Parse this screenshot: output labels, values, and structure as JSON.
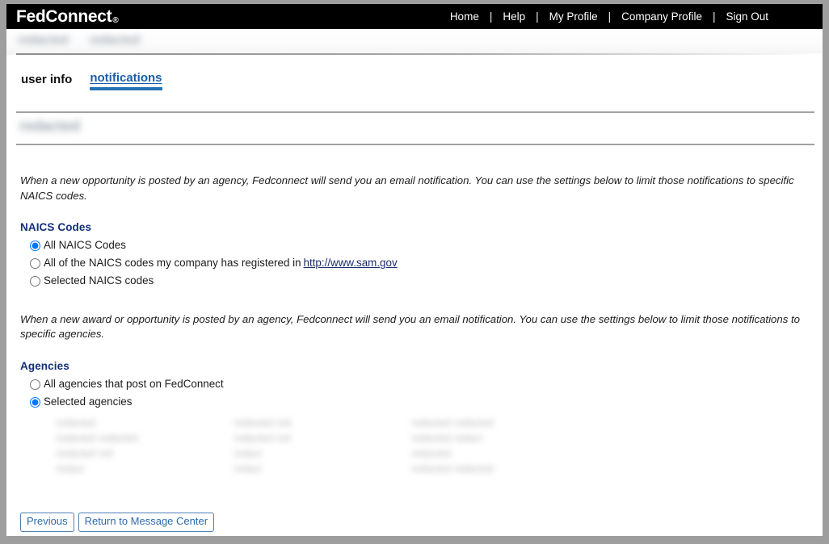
{
  "header": {
    "brand": "FedConnect",
    "brand_mark": "®",
    "nav": [
      {
        "label": "Home"
      },
      {
        "label": "Help"
      },
      {
        "label": "My Profile"
      },
      {
        "label": "Company Profile"
      },
      {
        "label": "Sign Out"
      }
    ],
    "nav_separator": "|"
  },
  "breadcrumb": {
    "item1": "redacted",
    "item2": "redacted"
  },
  "tabs": [
    {
      "label": "user info",
      "active": false
    },
    {
      "label": "notifications",
      "active": true
    }
  ],
  "page_title": "redacted",
  "naics": {
    "intro": "When a new opportunity is posted by an agency, Fedconnect will send you an email notification. You can use the settings below to limit those notifications to specific NAICS codes.",
    "heading": "NAICS Codes",
    "options": [
      {
        "label": "All NAICS Codes",
        "selected": true
      },
      {
        "label": "All of the NAICS codes my company has registered in",
        "link": "http://www.sam.gov",
        "selected": false
      },
      {
        "label": "Selected NAICS codes",
        "selected": false
      }
    ]
  },
  "agencies": {
    "intro": "When a new award or opportunity is posted by an agency, Fedconnect will send you an email notification. You can use the settings below to limit those notifications to specific agencies.",
    "heading": "Agencies",
    "options": [
      {
        "label": "All agencies that post on FedConnect",
        "selected": false
      },
      {
        "label": "Selected agencies",
        "selected": true
      }
    ],
    "redacted_columns": [
      [
        "redacted",
        "redacted redacted",
        "redacted red",
        "redact"
      ],
      [
        "redacted red",
        "redacted red",
        "redact",
        "redact"
      ],
      [
        "redacted redacted",
        "redacted redact",
        "redacted",
        "redacted redacted"
      ]
    ]
  },
  "footer": {
    "previous_label": "Previous",
    "return_label": "Return to Message Center"
  },
  "colors": {
    "header_bg": "#000000",
    "accent_blue": "#2572b4",
    "heading_navy": "#14307a",
    "link_navy": "#1a2d6b",
    "button_blue": "#2d6bb0",
    "frame_gray": "#9e9e9e"
  }
}
